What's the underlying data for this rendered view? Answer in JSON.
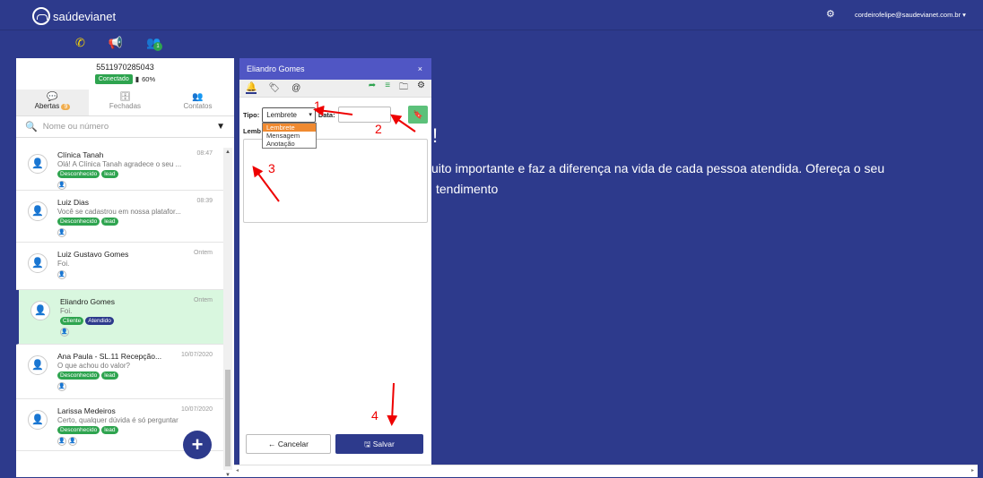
{
  "topbar": {
    "brand": "saúdevianet",
    "user_email": "cordeirofelipe@saudevianet.com.br ▾"
  },
  "channels": {
    "group_badge": "1"
  },
  "left": {
    "phone": "5511970285043",
    "status": "Conectado",
    "battery": "60%",
    "tabs": [
      {
        "label": "Abertas",
        "count": "9"
      },
      {
        "label": "Fechadas"
      },
      {
        "label": "Contatos"
      }
    ],
    "search_placeholder": "Nome ou número",
    "conversations": [
      {
        "name": "Clínica Tanah",
        "time": "08:47",
        "msg": "Olá! A Clínica Tanah agradece o seu ...",
        "tags": [
          "Desconhecido",
          "lead"
        ]
      },
      {
        "name": "Luiz Dias",
        "time": "08:39",
        "msg": "Você se cadastrou em nossa platafor...",
        "tags": [
          "Desconhecido",
          "lead"
        ]
      },
      {
        "name": "Luiz Gustavo Gomes",
        "time": "Ontem",
        "msg": "Foi.",
        "tags": []
      },
      {
        "name": "Eliandro Gomes",
        "time": "Ontem",
        "msg": "Foi.",
        "tags": [
          "Cliente",
          "Atendido"
        ]
      },
      {
        "name": "Ana Paula - SL.11 Recepção...",
        "time": "10/07/2020",
        "msg": "O que achou do valor?",
        "tags": [
          "Desconhecido",
          "lead"
        ]
      },
      {
        "name": "Larissa Medeiros",
        "time": "10/07/2020",
        "msg": "Certo, qualquer dúvida é só perguntar",
        "tags": [
          "Desconhecido",
          "lead"
        ]
      }
    ]
  },
  "modal": {
    "title": "Eliandro Gomes",
    "close": "×",
    "tipo_label": "Tipo:",
    "tipo_value": "Lembrete",
    "data_label": "Data:",
    "lembrete_label": "Lemb",
    "options": [
      "Lembrete",
      "Mensagem",
      "Anotação"
    ],
    "cancel": "← Cancelar",
    "save": "🖫 Salvar"
  },
  "welcome": {
    "heading": "!",
    "line1": "uito importante e faz a diferença na vida de cada pessoa atendida. Ofereça o seu",
    "line2": "tendimento"
  },
  "annotations": [
    "1",
    "2",
    "3",
    "4"
  ],
  "colors": {
    "brand": "#2d3a8c",
    "green": "#2ea44f",
    "modal_head": "#5056c4",
    "highlight": "#f08a30"
  }
}
